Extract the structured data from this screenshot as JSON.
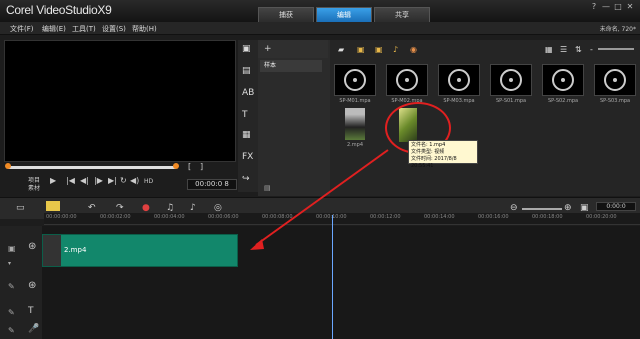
{
  "app": {
    "logo": "Corel VideoStudioX9",
    "right_status": "未命名, 720*"
  },
  "tabs": [
    "捕获",
    "编辑",
    "共享"
  ],
  "window_buttons": [
    "?",
    "—",
    "□",
    "✕"
  ],
  "menu": [
    "文件(F)",
    "编辑(E)",
    "工具(T)",
    "设置(S)",
    "帮助(H)"
  ],
  "preview": {
    "mode_label": "项目",
    "mode_label2": "素材",
    "timecode": "00:00:0 8",
    "hd": "HD"
  },
  "tool_icons": [
    "media-icon",
    "instant-project-icon",
    "transition-icon",
    "title-icon",
    "graphic-icon",
    "fx-icon",
    "path-icon"
  ],
  "tool_glyphs": [
    "▣",
    "▤",
    "AB",
    "T",
    "▦",
    "FX",
    "↪"
  ],
  "library": {
    "folder": "样本",
    "add_label": "+"
  },
  "clips": [
    {
      "caption": "SP-M01.mpa",
      "kind": "audio"
    },
    {
      "caption": "SP-M02.mpa",
      "kind": "audio"
    },
    {
      "caption": "SP-M03.mpa",
      "kind": "audio"
    },
    {
      "caption": "SP-S01.mpa",
      "kind": "audio"
    },
    {
      "caption": "SP-S02.mpa",
      "kind": "audio"
    },
    {
      "caption": "SP-S03.mpa",
      "kind": "audio"
    },
    {
      "caption": "2.mp4",
      "kind": "video"
    },
    {
      "caption": "1.mp4",
      "kind": "video"
    }
  ],
  "tooltip": {
    "line1": "文件名: 1.mp4",
    "line2": "文件类型: 视频",
    "line3": "文件时间: 2017/8/8 20:55:41"
  },
  "ruler": [
    "00:00:00:00",
    "00:00:02:00",
    "00:00:04:00",
    "00:00:06:00",
    "00:00:08:00",
    "00:00:10:00",
    "00:00:12:00",
    "00:00:14:00",
    "00:00:16:00",
    "00:00:18:00",
    "00:00:20:00"
  ],
  "timeline_clip": {
    "label": "2.mp4",
    "color": "#12876b"
  },
  "colors": {
    "accent": "#1a6fb8",
    "annotation": "#e02020",
    "playhead": "#6aa7ff"
  }
}
